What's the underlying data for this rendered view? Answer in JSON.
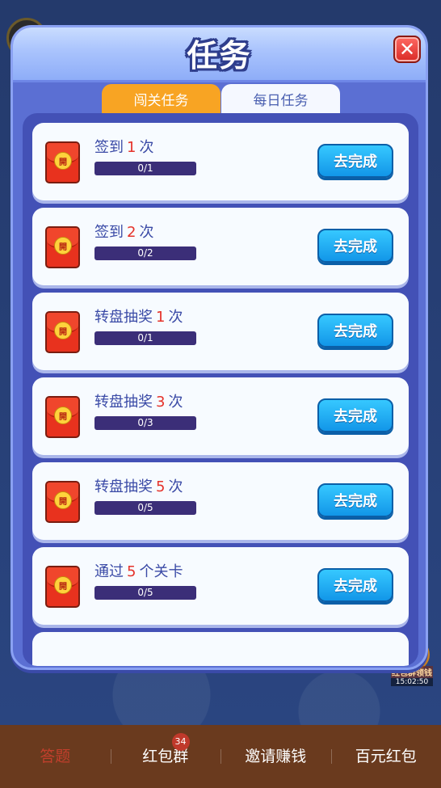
{
  "background": {
    "side_badge_text": "红包群领钱",
    "side_badge_time": "15:02:50"
  },
  "modal": {
    "title": "任务",
    "close_icon": "close-icon",
    "tabs": [
      {
        "label": "闯关任务",
        "active": true
      },
      {
        "label": "每日任务",
        "active": false
      }
    ],
    "tasks": [
      {
        "prefix": "签到",
        "count": "1",
        "suffix": "次",
        "progress_text": "0/1",
        "progress": 0,
        "button": "去完成",
        "icon": "red-envelope-icon",
        "seal": "開"
      },
      {
        "prefix": "签到",
        "count": "2",
        "suffix": "次",
        "progress_text": "0/2",
        "progress": 0,
        "button": "去完成",
        "icon": "red-envelope-icon",
        "seal": "開"
      },
      {
        "prefix": "转盘抽奖",
        "count": "1",
        "suffix": "次",
        "progress_text": "0/1",
        "progress": 0,
        "button": "去完成",
        "icon": "red-envelope-icon",
        "seal": "開"
      },
      {
        "prefix": "转盘抽奖",
        "count": "3",
        "suffix": "次",
        "progress_text": "0/3",
        "progress": 0,
        "button": "去完成",
        "icon": "red-envelope-icon",
        "seal": "開"
      },
      {
        "prefix": "转盘抽奖",
        "count": "5",
        "suffix": "次",
        "progress_text": "0/5",
        "progress": 0,
        "button": "去完成",
        "icon": "red-envelope-icon",
        "seal": "開"
      },
      {
        "prefix": "通过",
        "count": "5",
        "suffix": "个关卡",
        "progress_text": "0/5",
        "progress": 0,
        "button": "去完成",
        "icon": "red-envelope-icon",
        "seal": "開"
      }
    ]
  },
  "bottom_nav": {
    "items": [
      {
        "label": "答题",
        "active": true
      },
      {
        "label": "红包群",
        "badge": "34"
      },
      {
        "label": "邀请赚钱"
      },
      {
        "label": "百元红包"
      }
    ]
  },
  "colors": {
    "modal_bg": "#5b6fd3",
    "tab_active": "#f8a423",
    "button_blue": "#1296e8",
    "highlight_red": "#e5322a",
    "nav_bg": "#6a3a1e"
  }
}
